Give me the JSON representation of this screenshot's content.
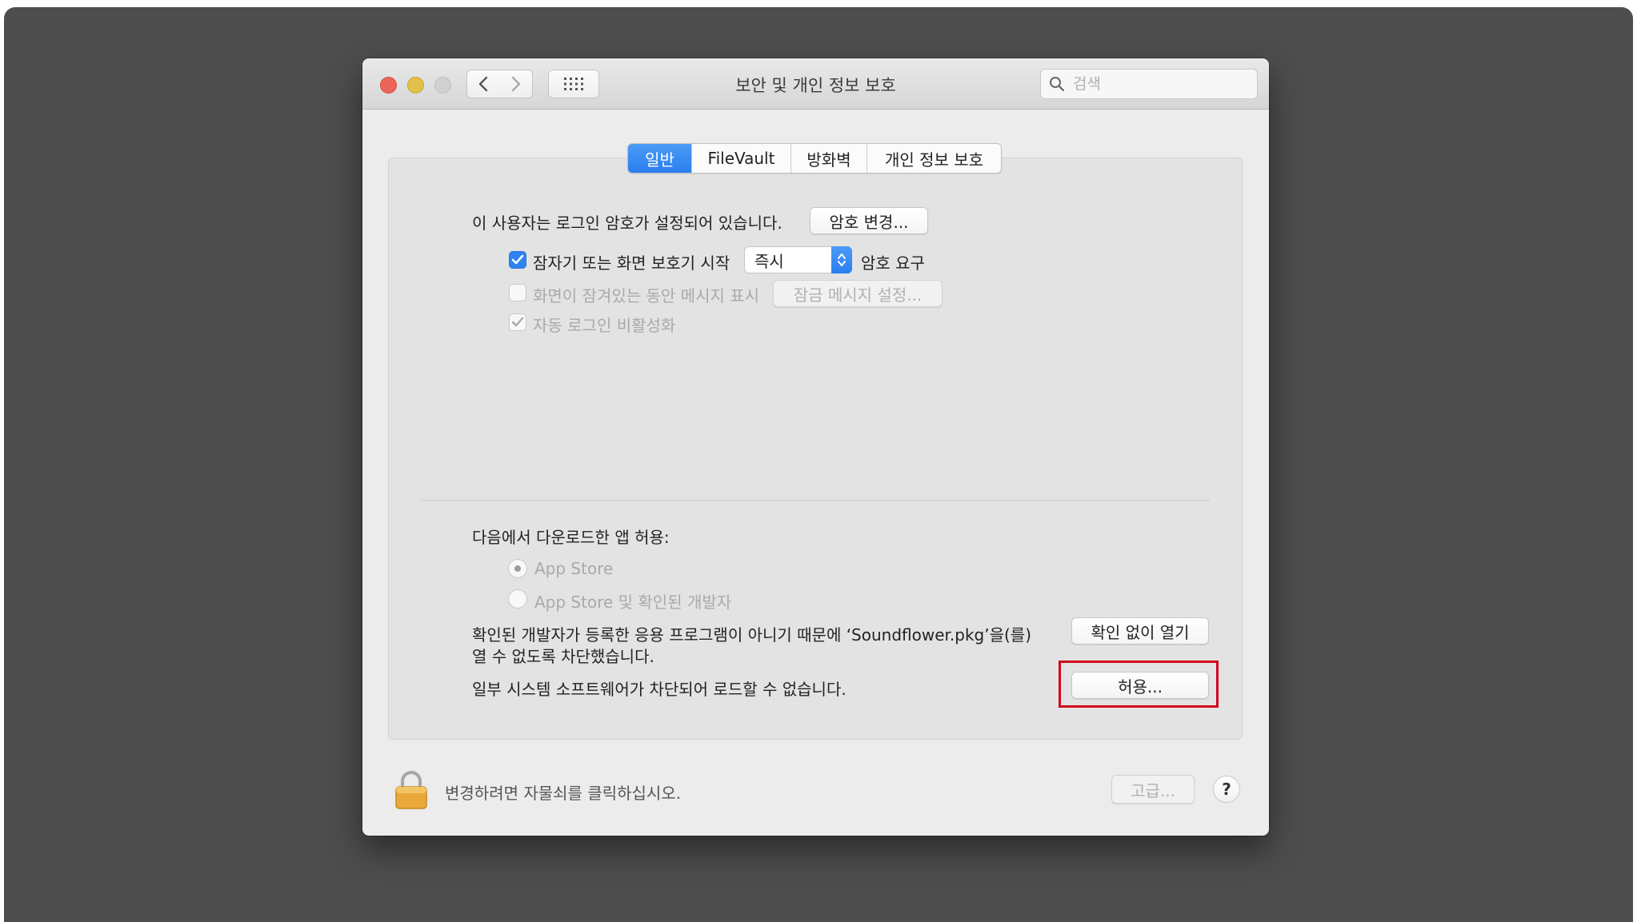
{
  "window": {
    "title": "보안 및 개인 정보 보호",
    "search_placeholder": "검색"
  },
  "tabs": [
    {
      "label": "일반",
      "active": true
    },
    {
      "label": "FileVault",
      "active": false
    },
    {
      "label": "방화벽",
      "active": false
    },
    {
      "label": "개인 정보 보호",
      "active": false
    }
  ],
  "general": {
    "password_text": "이 사용자는 로그인 암호가 설정되어 있습니다.",
    "change_password_button": "암호 변경...",
    "require_password": {
      "label": "잠자기 또는 화면 보호기 시작",
      "checked": true
    },
    "require_delay_value": "즉시",
    "require_suffix": "암호 요구",
    "lock_message": {
      "label": "화면이 잠겨있는 동안 메시지 표시",
      "checked": false
    },
    "lock_message_button": "잠금 메시지 설정...",
    "disable_autologin": {
      "label": "자동 로그인 비활성화",
      "checked": true
    }
  },
  "downloads": {
    "heading": "다음에서 다운로드한 앱 허용:",
    "options": [
      {
        "label": "App Store",
        "selected": true
      },
      {
        "label": "App Store 및 확인된 개발자",
        "selected": false
      }
    ],
    "blocked_line1": "확인된 개발자가 등록한 응용 프로그램이 아니기 때문에 ‘Soundflower.pkg’을(를)",
    "blocked_line2": "열 수 없도록 차단했습니다.",
    "open_anyway_button": "확인 없이 열기",
    "system_blocked_text": "일부 시스템 소프트웨어가 차단되어 로드할 수 없습니다.",
    "allow_button": "허용..."
  },
  "footer": {
    "lock_text": "변경하려면 자물쇠를 클릭하십시오.",
    "advanced_button": "고급...",
    "help_button": "?"
  },
  "colors": {
    "accent": "#2a7ef0",
    "highlight": "#d0021b",
    "desktop": "#4d4d4d"
  }
}
